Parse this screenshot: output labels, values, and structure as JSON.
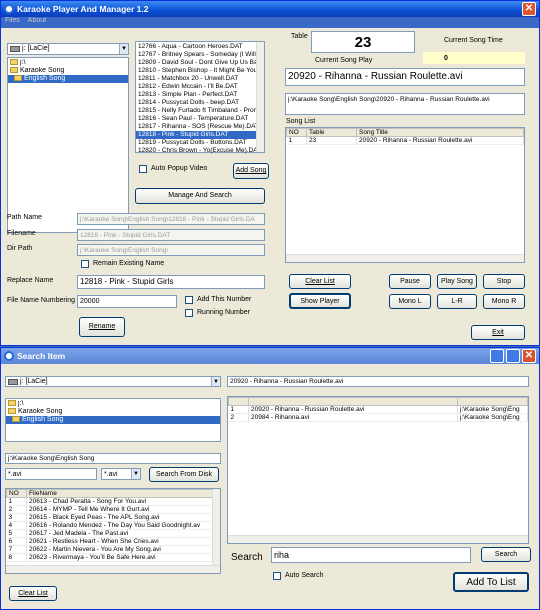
{
  "win1": {
    "title": "Karaoke Player And Manager 1.2",
    "menu": [
      "Files",
      "About"
    ],
    "drive": "j: [LaCie]",
    "folders": [
      "j:\\",
      "Karaoke Song",
      "English Song"
    ],
    "files": [
      "12766 - Aqua - Cartoon Heroes.DAT",
      "12767 - Britney Spears - Someday (I Will U",
      "12809 - David Soul - Dont Give Up Us Bal",
      "12810 - Stephen Bishop - It Might Be You.",
      "12811 - Matchbox 20 - Unwell.DAT",
      "12812 - Edwin Mccain - I'll Be.DAT",
      "12813 - Simple Plan - Perfect.DAT",
      "12814 - Pussycat Dolls - beep.DAT",
      "12815 - Nelly Furtado ft Timbaland - Promi",
      "12816 - Sean Paul - Temperature.DAT",
      "12817 - Rihanna - SOS (Rescue Me).DAT",
      "12818 - Pink - Stupid Girls.DAT",
      "12819 - Pussycat Dolls - Buttons.DAT",
      "12820 - Chris Brown - Yo(Excuse Me).DAT"
    ],
    "auto_popup_label": "Auto Popup Video",
    "add_song": "Add Song",
    "manage_search": "Manage And Search",
    "table_label": "Table",
    "table_value": "23",
    "current_song_time_label": "Current Song Time",
    "current_song_time": "0",
    "current_song_play_label": "Current Song Play",
    "current_song_play": "20920 - Rihanna - Russian Roulette.avi",
    "current_path": "j:\\Karaoke Song\\English Song\\20920 - Rihanna - Russian Roulette.avi",
    "song_list_label": "Song List",
    "song_cols": [
      "NO",
      "Table",
      "Song Title"
    ],
    "song_rows": [
      [
        "1",
        "23",
        "20920 - Rihanna - Russian Roulette.avi"
      ]
    ],
    "path_name_label": "Path Name",
    "path_name": "j:\\Karaoke Song\\English Song\\12818 - Pink - Stupid Girls.DA",
    "filename_label": "Filename",
    "filename": "12818 - Pink - Stupid Girls.DAT",
    "dir_path_label": "Dir Path",
    "dir_path": "j:\\Karaoke Song\\English Song\\",
    "remain_label": "Remain Existing Name",
    "replace_label": "Replace Name",
    "replace_value": "12818 - Pink - Stupid Girls",
    "numbering_label": "File Name Numbering",
    "numbering_value": "20000",
    "add_this_number": "Add This Number",
    "running_number": "Running Number",
    "rename": "Rename",
    "clear_list": "Clear List",
    "show_player": "Show Player",
    "pause": "Pause",
    "play_song": "Play Song",
    "stop": "Stop",
    "mono_l": "Mono L",
    "lr": "L-R",
    "mono_r": "Mono R",
    "exit": "Exit"
  },
  "win2": {
    "title": "Search Item",
    "drive": "j: [LaCie]",
    "selected_file": "20920 - Rihanna - Russian Roulette.avi",
    "folders": [
      "j:\\",
      "Karaoke Song",
      "English Song"
    ],
    "path": "j:\\Karaoke Song\\English Song",
    "ext_value": "*.avi",
    "ext_select": "*.avi",
    "search_from_disk": "Search From Disk",
    "file_cols": [
      "NO",
      "FileName"
    ],
    "file_rows": [
      [
        "1",
        "20613 - Chad Peralta - Song For You.avi"
      ],
      [
        "2",
        "20614 - MYMP - Tell Me Where It Gurt.avi"
      ],
      [
        "3",
        "20615 - Black Eyed Peas - The APL Song.avi"
      ],
      [
        "4",
        "20616 - Rolando Mendez - The Day You Said Goodnight.av"
      ],
      [
        "5",
        "20617 - Jed Madela - The Past.avi"
      ],
      [
        "6",
        "20621 - Restless Heart - When She Cries.avi"
      ],
      [
        "7",
        "20622 - Martin Nievera - You Are My Song.avi"
      ],
      [
        "8",
        "20623 - Rivermaya - You'll Be Safe Here.avi"
      ]
    ],
    "results": [
      [
        "1",
        "20920 - Rihanna - Russian Roulette.avi",
        "j:\\Karaoke Song\\Eng"
      ],
      [
        "2",
        "20984 - Rihanna.avi",
        "j:\\Karaoke Song\\Eng"
      ]
    ],
    "search_label": "Search",
    "search_value": "riha",
    "search_btn": "Search",
    "auto_search": "Auto Search",
    "add_to_list": "Add To List",
    "clear_list": "Clear List"
  }
}
